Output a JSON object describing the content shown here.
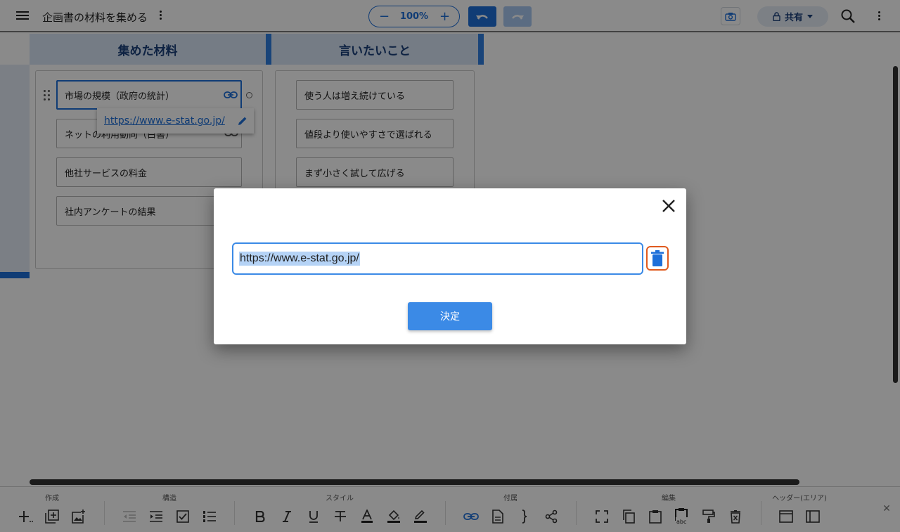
{
  "header": {
    "doc_title": "企画書の材料を集める",
    "zoom_minus": "−",
    "zoom_value": "100%",
    "zoom_plus": "+",
    "share_label": "共有"
  },
  "board": {
    "columns": [
      {
        "title": "集めた材料",
        "items": [
          "市場の規模（政府の統計）",
          "ネットの利用動向（白書）",
          "他社サービスの料金",
          "社内アンケートの結果"
        ]
      },
      {
        "title": "言いたいこと",
        "items": [
          "使う人は増え続けている",
          "値段より使いやすさで選ばれる",
          "まず小さく試して広げる"
        ]
      }
    ],
    "link_popup_url": "https://www.e-stat.go.jp/"
  },
  "toolbar": {
    "groups": [
      "作成",
      "構造",
      "スタイル",
      "付属",
      "編集",
      "ヘッダー(エリア)"
    ]
  },
  "dialog": {
    "url_value": "https://www.e-stat.go.jp/",
    "ok_label": "決定"
  },
  "colors": {
    "accent": "#1e6fd9",
    "delete_highlight": "#e05a1e",
    "overlay": "rgba(0,0,0,0.46)"
  }
}
